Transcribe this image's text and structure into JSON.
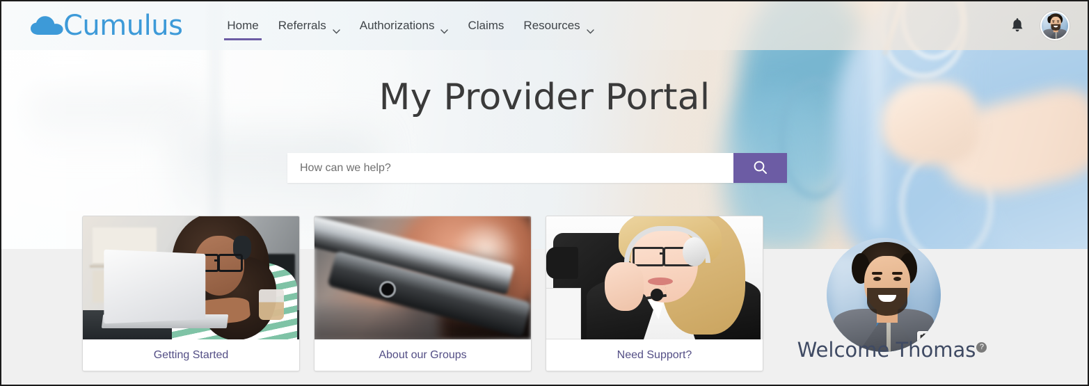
{
  "brand": {
    "name": "Cumulus",
    "logo_icon": "cloud-icon",
    "logo_color": "#3d9ad8"
  },
  "nav": {
    "items": [
      {
        "label": "Home",
        "has_dropdown": false,
        "active": true
      },
      {
        "label": "Referrals",
        "has_dropdown": true,
        "active": false
      },
      {
        "label": "Authorizations",
        "has_dropdown": true,
        "active": false
      },
      {
        "label": "Claims",
        "has_dropdown": false,
        "active": false
      },
      {
        "label": "Resources",
        "has_dropdown": true,
        "active": false
      }
    ],
    "active_underline_color": "#6c5ca4",
    "notifications_icon": "bell-icon",
    "avatar_icon": "user-avatar"
  },
  "hero": {
    "title": "My Provider Portal",
    "title_color": "#3a3a3a",
    "background": "blurred-clinician-stethoscope-photo"
  },
  "search": {
    "value": "",
    "placeholder": "How can we help?",
    "button_icon": "search-icon",
    "button_color": "#6c5ca4"
  },
  "cards": [
    {
      "label": "Getting Started",
      "image": "woman-at-laptop-photo"
    },
    {
      "label": "About our Groups",
      "image": "hand-holding-phone-photo"
    },
    {
      "label": "Need Support?",
      "image": "support-agent-headset-photo"
    }
  ],
  "card_label_color": "#534e85",
  "profile": {
    "photo": "user-profile-photo",
    "camera_icon": "camera-icon",
    "welcome_text": "Welcome Thomas",
    "help_icon": "question-mark-icon",
    "welcome_color": "#3f4a63"
  }
}
